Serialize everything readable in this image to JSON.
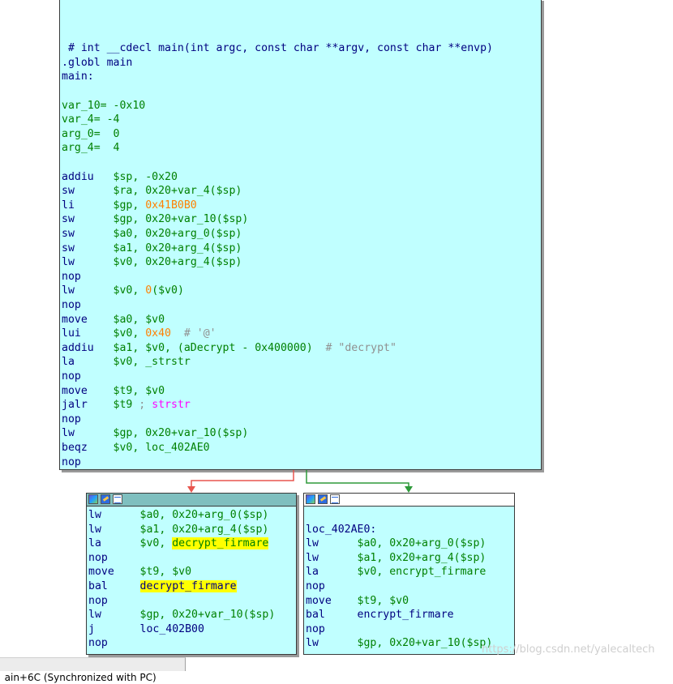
{
  "main_block": {
    "lines": [
      [],
      [],
      [
        {
          "t": " # int __cdecl main(int argc, const char **argv, const char **envp)",
          "c": "k"
        }
      ],
      [
        {
          "t": ".globl main",
          "c": "k"
        }
      ],
      [
        {
          "t": "main:",
          "c": "k"
        }
      ],
      [],
      [
        {
          "t": "var_10",
          "c": "g"
        },
        {
          "t": "= -0x10",
          "c": "g"
        }
      ],
      [
        {
          "t": "var_4",
          "c": "g"
        },
        {
          "t": "= -4",
          "c": "g"
        }
      ],
      [
        {
          "t": "arg_0",
          "c": "g"
        },
        {
          "t": "=  0",
          "c": "g"
        }
      ],
      [
        {
          "t": "arg_4",
          "c": "g"
        },
        {
          "t": "=  4",
          "c": "g"
        }
      ],
      [],
      [
        {
          "t": "addiu   ",
          "c": "k"
        },
        {
          "t": "$sp, -0x20",
          "c": "g"
        }
      ],
      [
        {
          "t": "sw      ",
          "c": "k"
        },
        {
          "t": "$ra, 0x20+",
          "c": "g"
        },
        {
          "t": "var_4",
          "c": "g"
        },
        {
          "t": "($sp)",
          "c": "g"
        }
      ],
      [
        {
          "t": "li      ",
          "c": "k"
        },
        {
          "t": "$gp, ",
          "c": "g"
        },
        {
          "t": "0x41B0B0",
          "c": "o"
        }
      ],
      [
        {
          "t": "sw      ",
          "c": "k"
        },
        {
          "t": "$gp, 0x20+",
          "c": "g"
        },
        {
          "t": "var_10",
          "c": "g"
        },
        {
          "t": "($sp)",
          "c": "g"
        }
      ],
      [
        {
          "t": "sw      ",
          "c": "k"
        },
        {
          "t": "$a0, 0x20+",
          "c": "g"
        },
        {
          "t": "arg_0",
          "c": "g"
        },
        {
          "t": "($sp)",
          "c": "g"
        }
      ],
      [
        {
          "t": "sw      ",
          "c": "k"
        },
        {
          "t": "$a1, 0x20+",
          "c": "g"
        },
        {
          "t": "arg_4",
          "c": "g"
        },
        {
          "t": "($sp)",
          "c": "g"
        }
      ],
      [
        {
          "t": "lw      ",
          "c": "k"
        },
        {
          "t": "$v0, 0x20+",
          "c": "g"
        },
        {
          "t": "arg_4",
          "c": "g"
        },
        {
          "t": "($sp)",
          "c": "g"
        }
      ],
      [
        {
          "t": "nop",
          "c": "k"
        }
      ],
      [
        {
          "t": "lw      ",
          "c": "k"
        },
        {
          "t": "$v0, ",
          "c": "g"
        },
        {
          "t": "0",
          "c": "o"
        },
        {
          "t": "($v0)",
          "c": "g"
        }
      ],
      [
        {
          "t": "nop",
          "c": "k"
        }
      ],
      [
        {
          "t": "move    ",
          "c": "k"
        },
        {
          "t": "$a0, $v0",
          "c": "g"
        }
      ],
      [
        {
          "t": "lui     ",
          "c": "k"
        },
        {
          "t": "$v0, ",
          "c": "g"
        },
        {
          "t": "0x40",
          "c": "o"
        },
        {
          "t": "  # '@'",
          "c": "gr"
        }
      ],
      [
        {
          "t": "addiu   ",
          "c": "k"
        },
        {
          "t": "$a1, $v0, (aDecrypt - 0x400000)",
          "c": "g"
        },
        {
          "t": "  # \"decrypt\"",
          "c": "gr"
        }
      ],
      [
        {
          "t": "la      ",
          "c": "k"
        },
        {
          "t": "$v0, _strstr",
          "c": "g"
        }
      ],
      [
        {
          "t": "nop",
          "c": "k"
        }
      ],
      [
        {
          "t": "move    ",
          "c": "k"
        },
        {
          "t": "$t9, $v0",
          "c": "g"
        }
      ],
      [
        {
          "t": "jalr    ",
          "c": "k"
        },
        {
          "t": "$t9",
          "c": "g"
        },
        {
          "t": " ; ",
          "c": "gr"
        },
        {
          "t": "strstr",
          "c": "m"
        }
      ],
      [
        {
          "t": "nop",
          "c": "k"
        }
      ],
      [
        {
          "t": "lw      ",
          "c": "k"
        },
        {
          "t": "$gp, 0x20+",
          "c": "g"
        },
        {
          "t": "var_10",
          "c": "g"
        },
        {
          "t": "($sp)",
          "c": "g"
        }
      ],
      [
        {
          "t": "beqz    ",
          "c": "k"
        },
        {
          "t": "$v0, loc_402AE0",
          "c": "g"
        }
      ],
      [
        {
          "t": "nop",
          "c": "k"
        }
      ]
    ]
  },
  "left_block": {
    "lines": [
      [
        {
          "t": "lw      ",
          "c": "k"
        },
        {
          "t": "$a0, 0x20+",
          "c": "g"
        },
        {
          "t": "arg_0",
          "c": "g"
        },
        {
          "t": "($sp)",
          "c": "g"
        }
      ],
      [
        {
          "t": "lw      ",
          "c": "k"
        },
        {
          "t": "$a1, 0x20+",
          "c": "g"
        },
        {
          "t": "arg_4",
          "c": "g"
        },
        {
          "t": "($sp)",
          "c": "g"
        }
      ],
      [
        {
          "t": "la      ",
          "c": "k"
        },
        {
          "t": "$v0, ",
          "c": "g"
        },
        {
          "t": "decrypt_firmare",
          "c": "g hl"
        }
      ],
      [
        {
          "t": "nop",
          "c": "k"
        }
      ],
      [
        {
          "t": "move    ",
          "c": "k"
        },
        {
          "t": "$t9, $v0",
          "c": "g"
        }
      ],
      [
        {
          "t": "bal     ",
          "c": "k"
        },
        {
          "t": "decrypt_firmare",
          "c": "bl hl"
        }
      ],
      [
        {
          "t": "nop",
          "c": "k"
        }
      ],
      [
        {
          "t": "lw      ",
          "c": "k"
        },
        {
          "t": "$gp, 0x20+",
          "c": "g"
        },
        {
          "t": "var_10",
          "c": "g"
        },
        {
          "t": "($sp)",
          "c": "g"
        }
      ],
      [
        {
          "t": "j       ",
          "c": "k"
        },
        {
          "t": "loc_402B00",
          "c": "bl"
        }
      ],
      [
        {
          "t": "nop",
          "c": "k"
        }
      ]
    ]
  },
  "right_block": {
    "lines": [
      [],
      [
        {
          "t": "loc_402AE0:",
          "c": "k"
        }
      ],
      [
        {
          "t": "lw      ",
          "c": "k"
        },
        {
          "t": "$a0, 0x20+",
          "c": "g"
        },
        {
          "t": "arg_0",
          "c": "g"
        },
        {
          "t": "($sp)",
          "c": "g"
        }
      ],
      [
        {
          "t": "lw      ",
          "c": "k"
        },
        {
          "t": "$a1, 0x20+",
          "c": "g"
        },
        {
          "t": "arg_4",
          "c": "g"
        },
        {
          "t": "($sp)",
          "c": "g"
        }
      ],
      [
        {
          "t": "la      ",
          "c": "k"
        },
        {
          "t": "$v0, encrypt_firmare",
          "c": "g"
        }
      ],
      [
        {
          "t": "nop",
          "c": "k"
        }
      ],
      [
        {
          "t": "move    ",
          "c": "k"
        },
        {
          "t": "$t9, $v0",
          "c": "g"
        }
      ],
      [
        {
          "t": "bal     ",
          "c": "k"
        },
        {
          "t": "encrypt_firmare",
          "c": "bl"
        }
      ],
      [
        {
          "t": "nop",
          "c": "k"
        }
      ],
      [
        {
          "t": "lw      ",
          "c": "k"
        },
        {
          "t": "$gp, 0x20+",
          "c": "g"
        },
        {
          "t": "var_10",
          "c": "g"
        },
        {
          "t": "($sp)",
          "c": "g"
        }
      ]
    ]
  },
  "colors": {
    "block_bg": "#c0ffff",
    "false_edge": "#e8554e",
    "true_edge": "#2e9a3a",
    "highlight": "#ffff00"
  },
  "block_icons": [
    "graph-icon",
    "edit-icon",
    "rename-icon"
  ],
  "status_bar": {
    "text": "ain+6C (Synchronized with PC)"
  },
  "watermark": "https://blog.csdn.net/yalecaltech"
}
